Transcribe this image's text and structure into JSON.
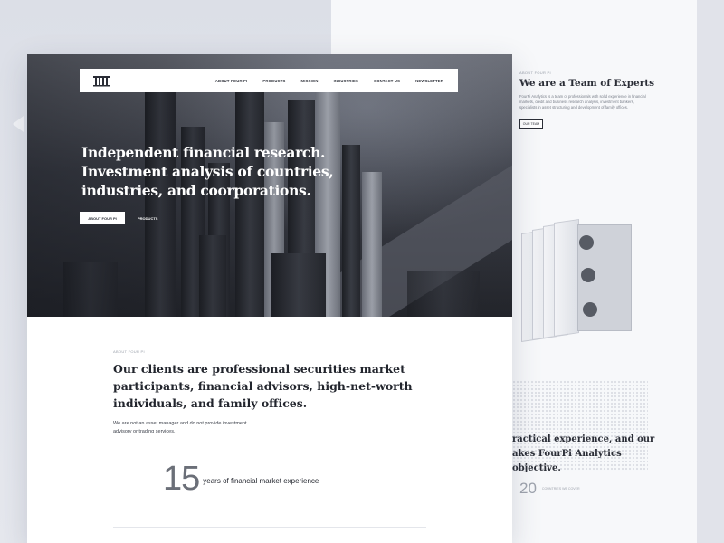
{
  "nav": {
    "items": [
      "ABOUT FOUR PI",
      "PRODUCTS",
      "MISSION",
      "INDUSTRIES",
      "CONTACT US",
      "NEWSLETTER"
    ]
  },
  "hero": {
    "title_lines": [
      "Independent financial research.",
      "Investment analysis of countries,",
      "industries, and coorporations."
    ],
    "primary_button": "ABOUT FOUR PI",
    "secondary_button": "PRODUCTS"
  },
  "about": {
    "label": "ABOUT FOUR PI",
    "title_lines": [
      "Our clients are professional securities market",
      "participants, financial advisors, high-net-worth",
      "individuals, and family offices."
    ],
    "text_lines": [
      "We are not an asset manager and do not provide investment",
      "advisory or trading services."
    ],
    "stat_number": "15",
    "stat_label": "years of financial market experience"
  },
  "back_page": {
    "label": "ABOUT FOUR PI",
    "title": "We are a Team of Experts",
    "paragraph": "FourPi Analytics is a team of professionals with solid experience in financial markets, credit and business research analysis, investment bankers, specialists in asset structuring and development of family offices.",
    "button": "OUR TEAM",
    "quote_lines": [
      "ractical experience, and our",
      "akes FourPi Analytics",
      "objective."
    ],
    "stat_number": "20",
    "stat_label": "COUNTRIES WE COVER"
  },
  "colors": {
    "background": "#e3e5ec",
    "ink": "#22252d",
    "hero_dark": "#23252b",
    "white": "#ffffff"
  }
}
